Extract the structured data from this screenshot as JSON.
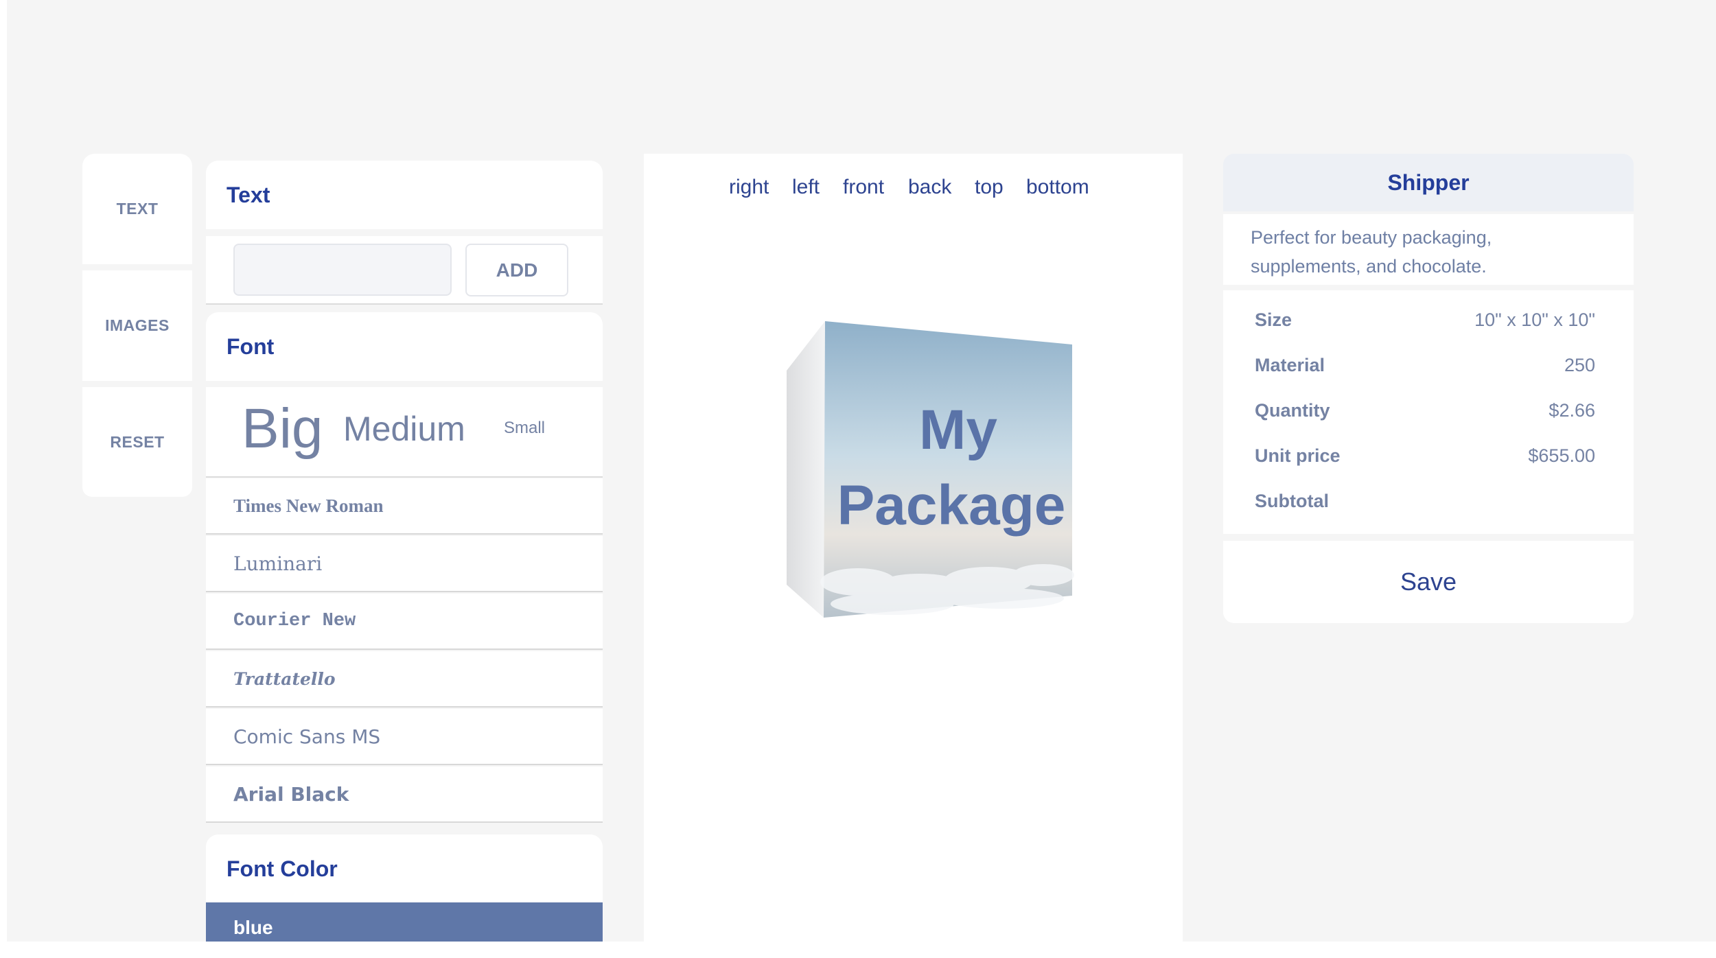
{
  "sidebar": {
    "tabs": [
      {
        "label": "TEXT"
      },
      {
        "label": "IMAGES"
      },
      {
        "label": "RESET"
      }
    ]
  },
  "text_panel": {
    "title": "Text",
    "input_value": "",
    "add_label": "ADD",
    "font_title": "Font",
    "sizes": {
      "big": "Big",
      "medium": "Medium",
      "small": "Small"
    },
    "fonts": [
      "Times New Roman",
      "Luminari",
      "Courier New",
      "Trattatello",
      "Comic Sans MS",
      "Arial Black"
    ],
    "color_title": "Font Color",
    "selected_color": "blue"
  },
  "preview": {
    "views": [
      "right",
      "left",
      "front",
      "back",
      "top",
      "bottom"
    ],
    "box_text_line1": "My",
    "box_text_line2": "Package"
  },
  "product": {
    "name": "Shipper",
    "description_line1": "Perfect for beauty packaging,",
    "description_line2": "supplements, and chocolate.",
    "specs": [
      {
        "label": "Size",
        "value": "10\" x 10\" x 10\""
      },
      {
        "label": "Material",
        "value": "250"
      },
      {
        "label": "Quantity",
        "value": "$2.66"
      },
      {
        "label": "Unit price",
        "value": "$655.00"
      },
      {
        "label": "Subtotal",
        "value": ""
      }
    ],
    "save_label": "Save"
  },
  "colors": {
    "accent_dark": "#243e9a",
    "muted_text": "#7482a3",
    "selected_color_bg": "#5f77a8",
    "app_background": "#f5f5f5"
  }
}
